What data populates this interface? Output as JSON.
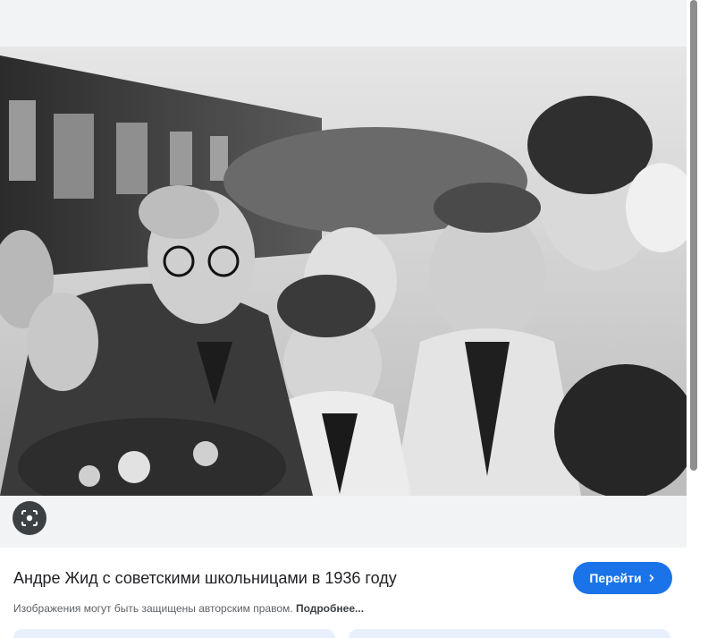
{
  "image": {
    "alt": "Андре Жид с советскими школьницами в 1936 году"
  },
  "lens_button": {
    "icon": "lens-icon"
  },
  "result": {
    "title": "Андре Жид с советскими школьницами в 1936 году",
    "visit_label": "Перейти",
    "visit_icon": "chevron-right-icon",
    "copyright_text": "Изображения могут быть защищены авторским правом.",
    "more_link": "Подробнее..."
  },
  "colors": {
    "accent": "#1a73e8",
    "panel_bg": "#f1f3f4",
    "text_primary": "#202124",
    "text_secondary": "#5f6368"
  }
}
